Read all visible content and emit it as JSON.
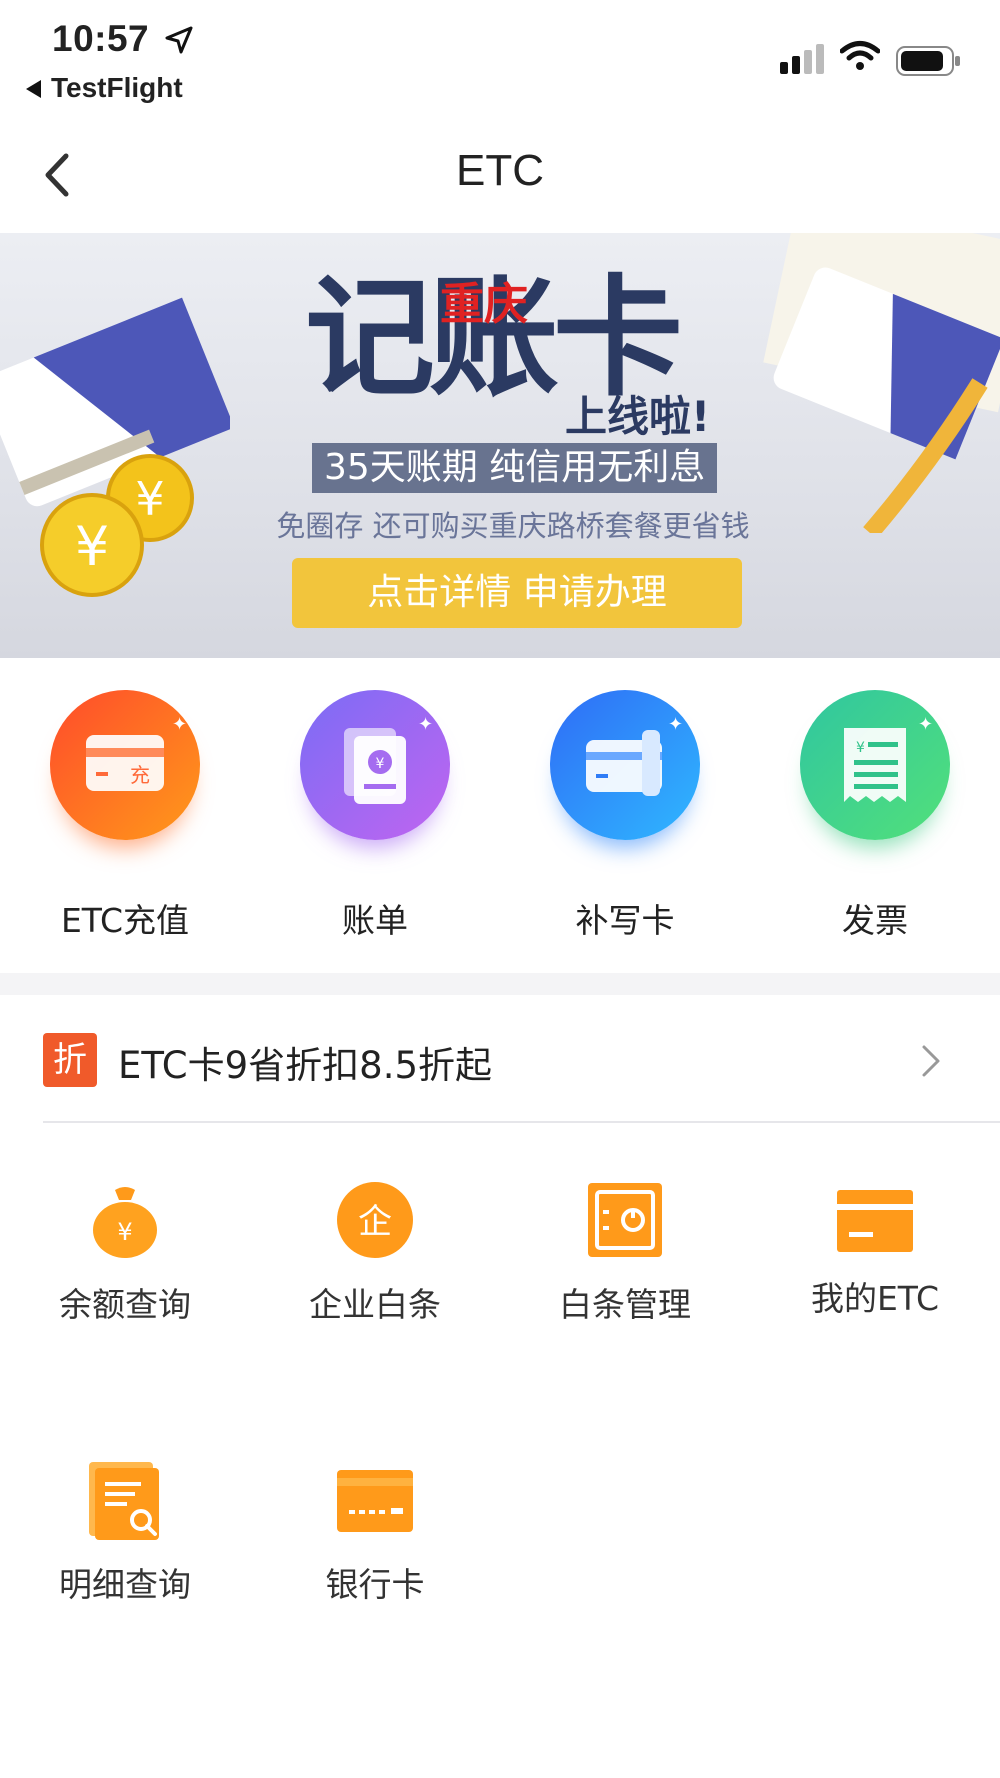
{
  "status_bar": {
    "time": "10:57",
    "back_app": "TestFlight"
  },
  "nav": {
    "title": "ETC"
  },
  "banner": {
    "title_top": "重庆",
    "title_main": "记账卡",
    "title_sub": "上线啦!",
    "pill": "35天账期  纯信用无利息",
    "line": "免圈存 还可购买重庆路桥套餐更省钱",
    "cta": "点击详情  申请办理"
  },
  "features": [
    {
      "label": "ETC充值",
      "icon": "card-recharge-icon",
      "color_from": "#ff5a2c",
      "color_to": "#ff9a1a"
    },
    {
      "label": "账单",
      "icon": "bill-icon",
      "color_from": "#8b6cf5",
      "color_to": "#c065f0"
    },
    {
      "label": "补写卡",
      "icon": "card-write-icon",
      "color_from": "#2f7cf6",
      "color_to": "#2fb4ff"
    },
    {
      "label": "发票",
      "icon": "invoice-icon",
      "color_from": "#31c98a",
      "color_to": "#4fe07a"
    }
  ],
  "promo": {
    "badge": "折",
    "text": "ETC卡9省折扣8.5折起"
  },
  "grid": [
    {
      "label": "余额查询",
      "icon": "money-bag-icon"
    },
    {
      "label": "企业白条",
      "icon": "enterprise-icon"
    },
    {
      "label": "白条管理",
      "icon": "safe-icon"
    },
    {
      "label": "我的ETC",
      "icon": "card-icon"
    },
    {
      "label": "明细查询",
      "icon": "detail-search-icon"
    },
    {
      "label": "银行卡",
      "icon": "bank-card-icon"
    }
  ],
  "colors": {
    "accent_orange": "#ff9a1a",
    "promo_red": "#f05a2a",
    "banner_cta": "#f2c53c"
  }
}
